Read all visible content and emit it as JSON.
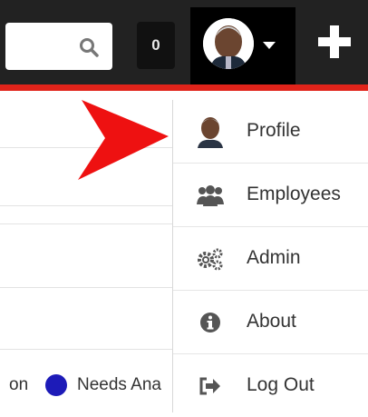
{
  "topbar": {
    "counter": "0",
    "colors": {
      "bar": "#222222",
      "accent_line": "#e0231a"
    }
  },
  "legend": {
    "partial_left": "on",
    "item_label": "Needs Ana",
    "item_color": "#1d1bb8"
  },
  "menu": {
    "items": [
      {
        "label": "Profile",
        "icon": "avatar-icon"
      },
      {
        "label": "Employees",
        "icon": "users-icon"
      },
      {
        "label": "Admin",
        "icon": "gears-icon"
      },
      {
        "label": "About",
        "icon": "info-circle-icon"
      },
      {
        "label": "Log Out",
        "icon": "sign-out-icon"
      }
    ]
  },
  "annotation": {
    "arrow_color": "#ee1111"
  }
}
